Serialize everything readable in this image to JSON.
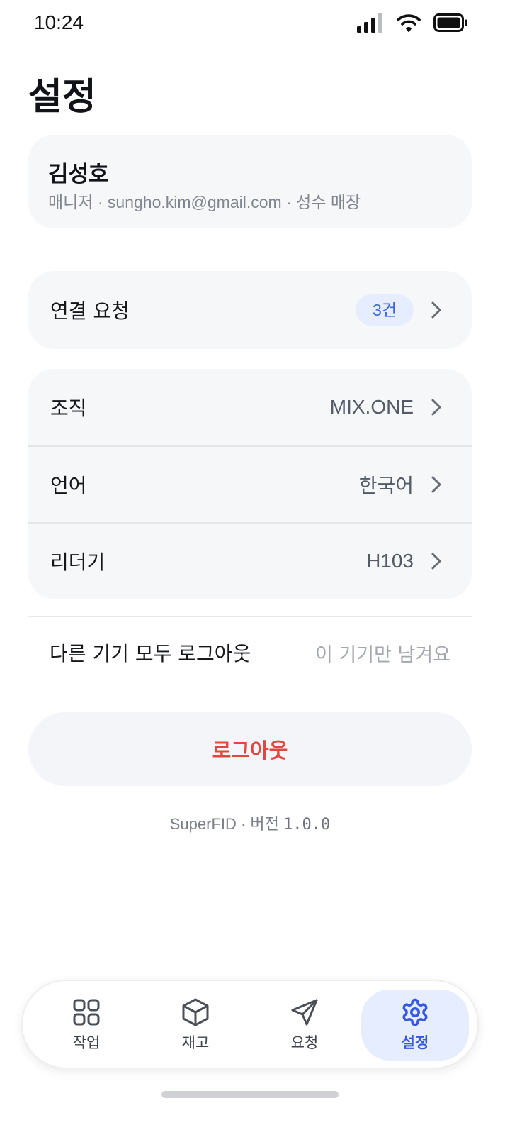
{
  "status_bar": {
    "time": "10:24"
  },
  "page": {
    "title": "설정"
  },
  "profile": {
    "name": "김성호",
    "meta": "매니저 · sungho.kim@gmail.com · 성수 매장"
  },
  "connection": {
    "label": "연결 요청",
    "badge": "3건"
  },
  "settings": {
    "organization": {
      "label": "조직",
      "value": "MIX.ONE"
    },
    "language": {
      "label": "언어",
      "value": "한국어"
    },
    "reader": {
      "label": "리더기",
      "value": "H103"
    }
  },
  "logout_all": {
    "label": "다른 기기 모두 로그아웃",
    "hint": "이 기기만 남겨요"
  },
  "logout": {
    "label": "로그아웃"
  },
  "version": {
    "prefix": "SuperFID · 버전 ",
    "number": "1.0.0"
  },
  "nav": {
    "items": [
      {
        "label": "작업",
        "icon": "grid-icon"
      },
      {
        "label": "재고",
        "icon": "box-icon"
      },
      {
        "label": "요청",
        "icon": "send-icon"
      },
      {
        "label": "설정",
        "icon": "gear-icon",
        "active": true
      }
    ]
  },
  "colors": {
    "accent": "#3557e4",
    "accent_bg": "#e6edfe",
    "danger": "#e2463f",
    "card_bg": "#f6f7f9"
  }
}
